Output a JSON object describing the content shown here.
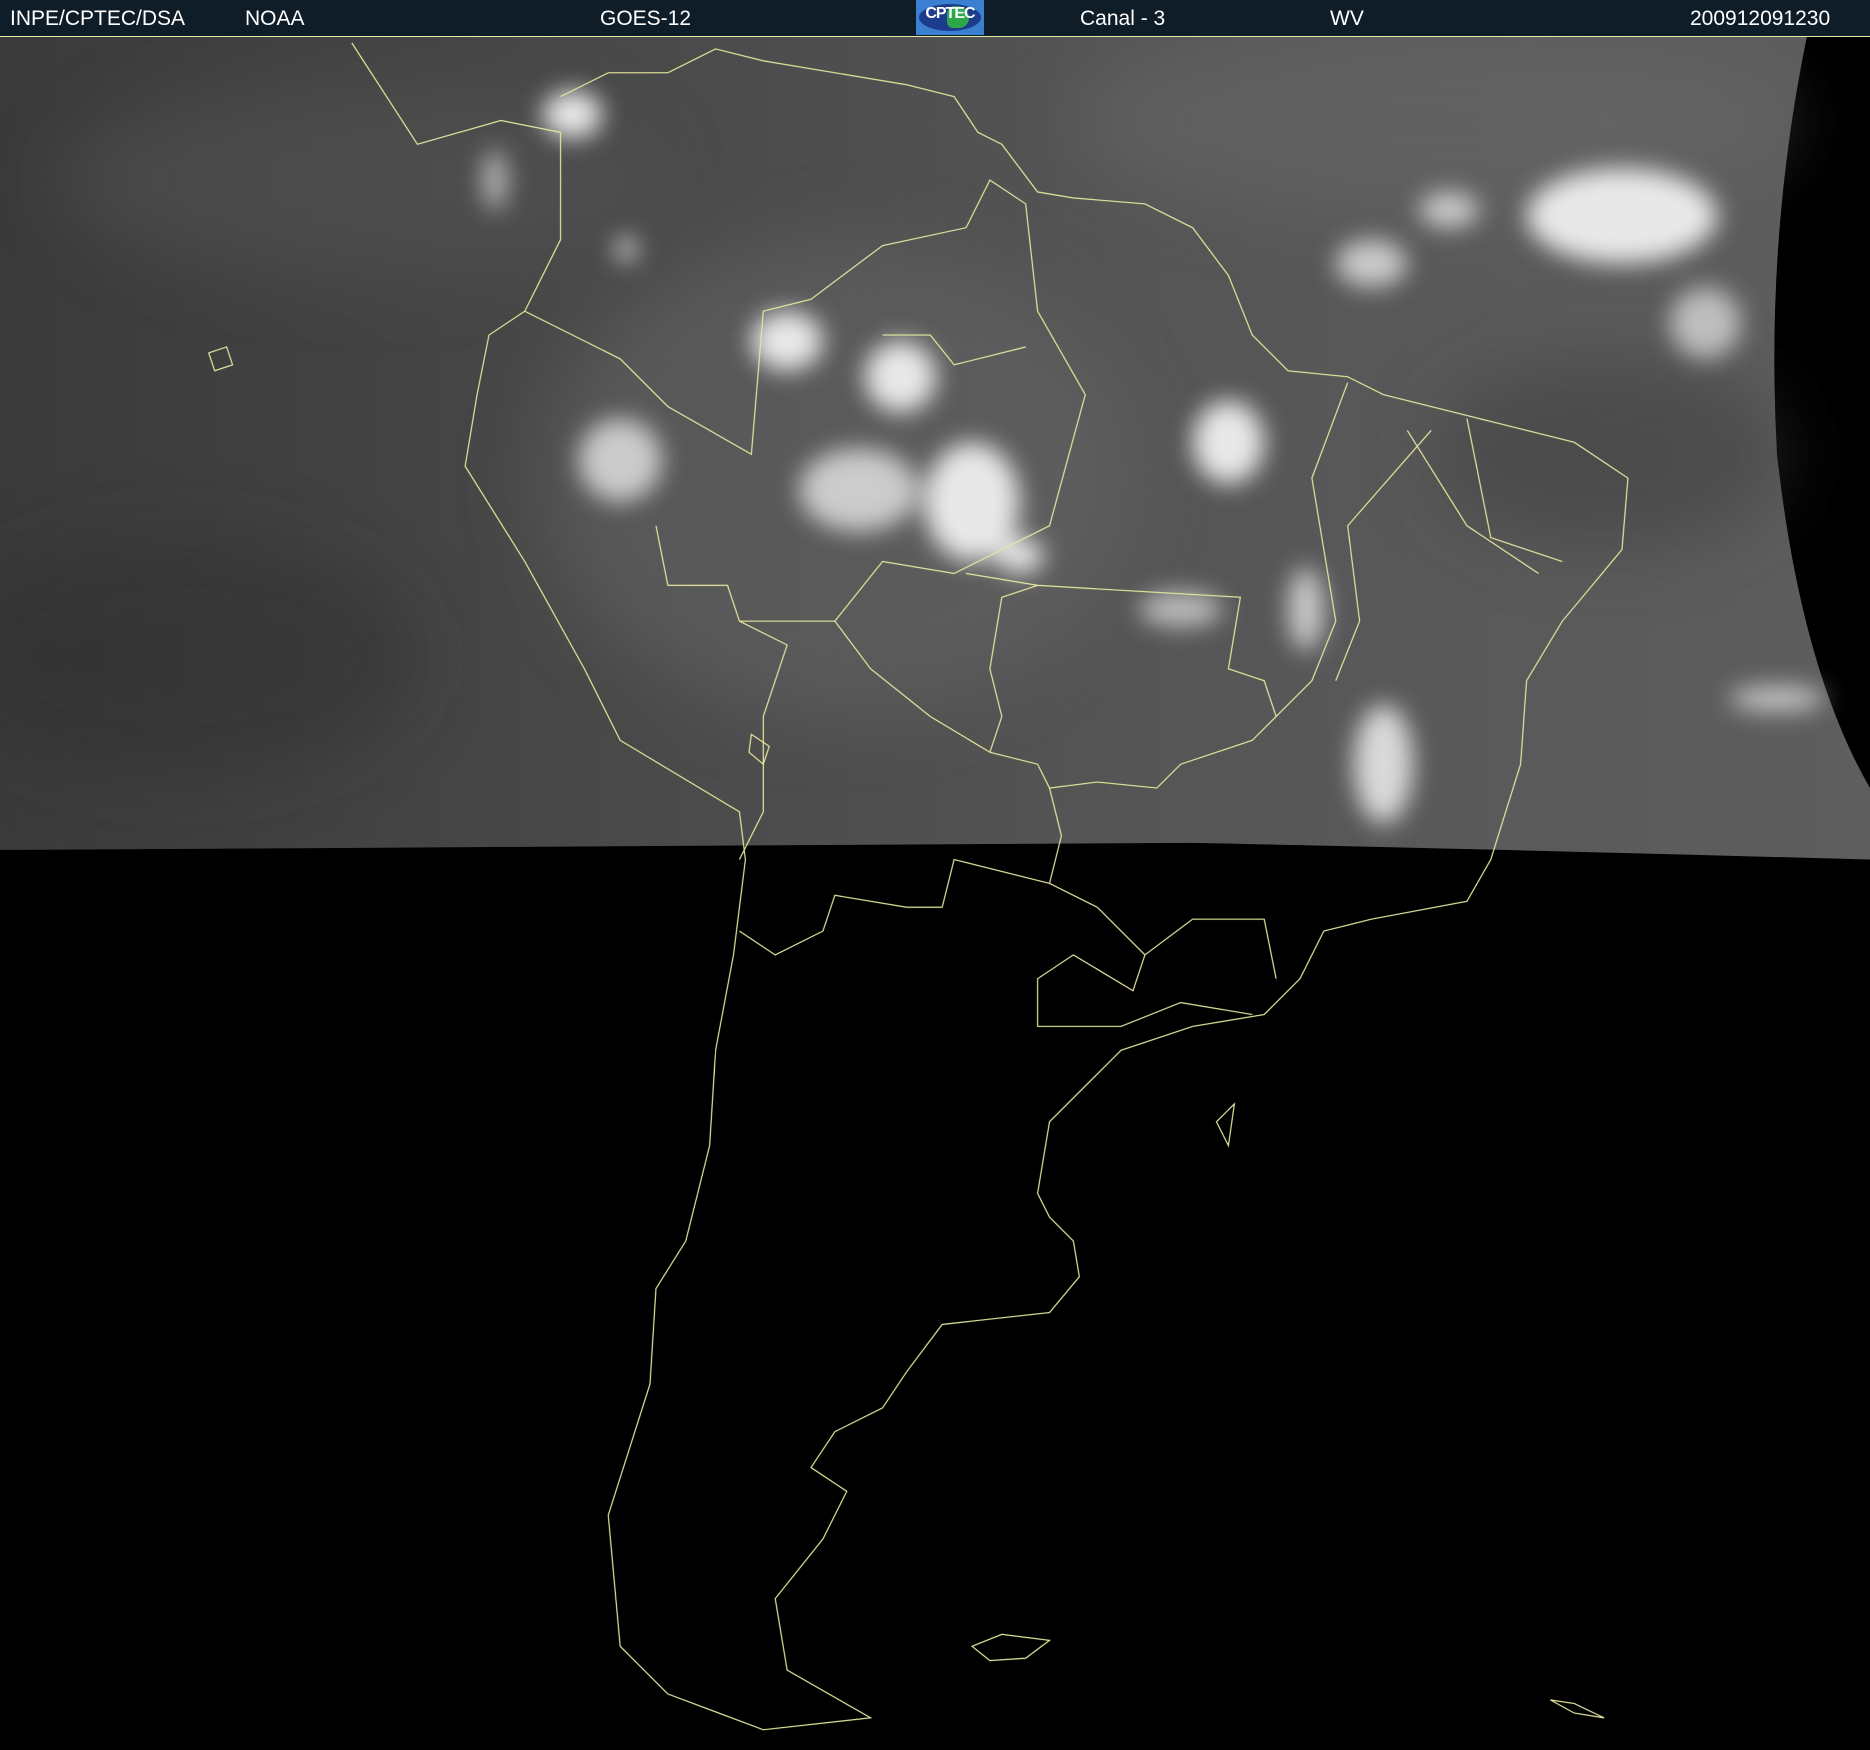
{
  "header": {
    "institution": "INPE/CPTEC/DSA",
    "agency": "NOAA",
    "satellite": "GOES-12",
    "logo_text": "CPTEC",
    "channel": "Canal - 3",
    "band": "WV",
    "timestamp": "200912091230"
  },
  "colors": {
    "header_bg": "#0f1d28",
    "coastline": "#e8e8a0",
    "logo_blue": "#3a7fd0"
  }
}
